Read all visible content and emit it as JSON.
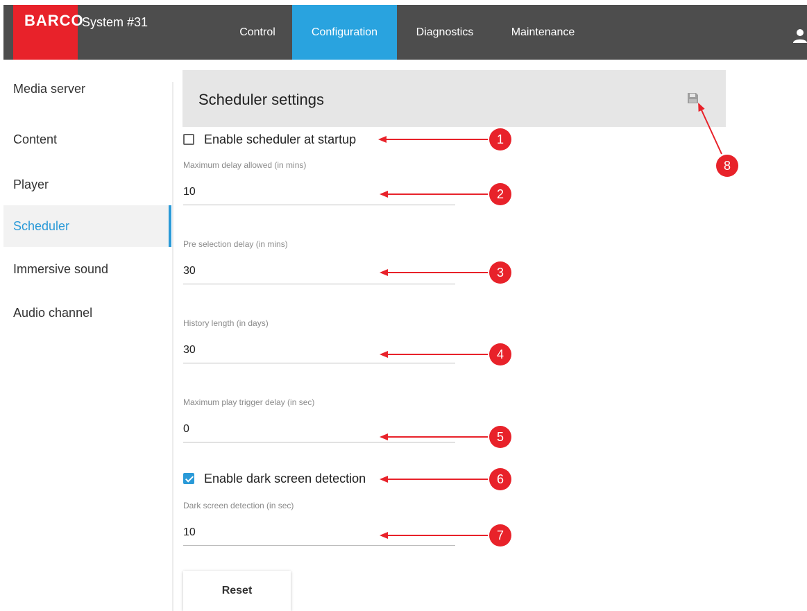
{
  "topbar": {
    "logo_text": "BARCO",
    "system_name": "System #31",
    "tabs": [
      {
        "label": "Control",
        "active": false
      },
      {
        "label": "Configuration",
        "active": true
      },
      {
        "label": "Diagnostics",
        "active": false
      },
      {
        "label": "Maintenance",
        "active": false
      }
    ],
    "user_icon": "user-icon"
  },
  "sidebar": {
    "items": [
      {
        "label": "Media server",
        "active": false
      },
      {
        "label": "Content",
        "active": false
      },
      {
        "label": "Player",
        "active": false
      },
      {
        "label": "Scheduler",
        "active": true
      },
      {
        "label": "Immersive sound",
        "active": false
      },
      {
        "label": "Audio channel",
        "active": false
      }
    ]
  },
  "panel": {
    "title": "Scheduler settings",
    "save_icon": "save-icon"
  },
  "form": {
    "enable_scheduler": {
      "label": "Enable scheduler at startup",
      "checked": false
    },
    "max_delay": {
      "label": "Maximum delay allowed (in mins)",
      "value": "10"
    },
    "pre_selection": {
      "label": "Pre selection delay (in mins)",
      "value": "30"
    },
    "history_length": {
      "label": "History length (in days)",
      "value": "30"
    },
    "max_play_trigger": {
      "label": "Maximum play trigger delay (in sec)",
      "value": "0"
    },
    "enable_dark_screen": {
      "label": "Enable dark screen detection",
      "checked": true
    },
    "dark_screen": {
      "label": "Dark screen detection (in sec)",
      "value": "10"
    },
    "reset_label": "Reset"
  },
  "callouts": [
    "1",
    "2",
    "3",
    "4",
    "5",
    "6",
    "7",
    "8"
  ],
  "colors": {
    "brand_red": "#e8222a",
    "topbar_bg": "#4d4d4d",
    "active_tab": "#29a3df",
    "accent_blue": "#2a9ad8",
    "header_bg": "#e6e6e6"
  }
}
